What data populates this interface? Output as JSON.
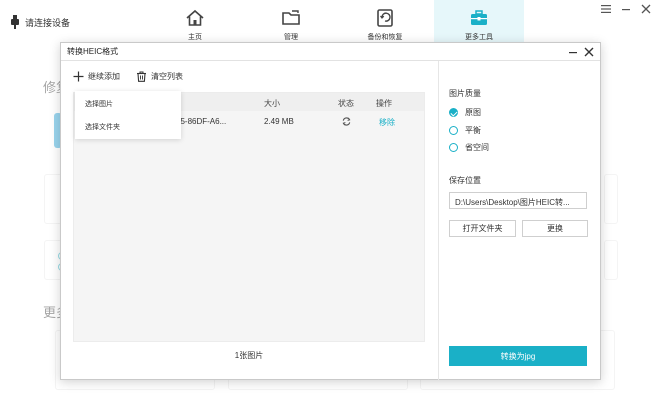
{
  "app": {
    "device_label": "请连接设备",
    "nav": [
      {
        "label": "主页",
        "icon": "home-icon"
      },
      {
        "label": "管理",
        "icon": "folder-icon"
      },
      {
        "label": "备份和恢复",
        "icon": "backup-restore-icon"
      },
      {
        "label": "更多工具",
        "icon": "toolbox-icon"
      }
    ],
    "active_nav": "更多工具",
    "bg_section_1": "修复",
    "bg_section_2": "更多",
    "accent_color": "#1ab0c7"
  },
  "dialog": {
    "title": "转换HEIC格式",
    "toolbar": {
      "add_label": "继续添加",
      "clear_label": "清空列表"
    },
    "dropdown": {
      "items": [
        "选择图片",
        "选择文件夹"
      ]
    },
    "table": {
      "headers": {
        "size": "大小",
        "status": "状态",
        "action": "操作"
      },
      "rows": [
        {
          "name": "25-86DF-A6...",
          "size": "2.49 MB",
          "status_icon": "refresh-icon",
          "action": "移除"
        }
      ]
    },
    "count_text": "1张图片",
    "quality": {
      "title": "图片质量",
      "options": [
        {
          "label": "原图",
          "selected": true
        },
        {
          "label": "平衡",
          "selected": false
        },
        {
          "label": "省空间",
          "selected": false
        }
      ]
    },
    "save": {
      "title": "保存位置",
      "path": "D:\\Users\\Desktop\\图片HEIC转...",
      "open_folder_label": "打开文件夹",
      "change_label": "更换"
    },
    "convert_label": "转换为jpg"
  }
}
